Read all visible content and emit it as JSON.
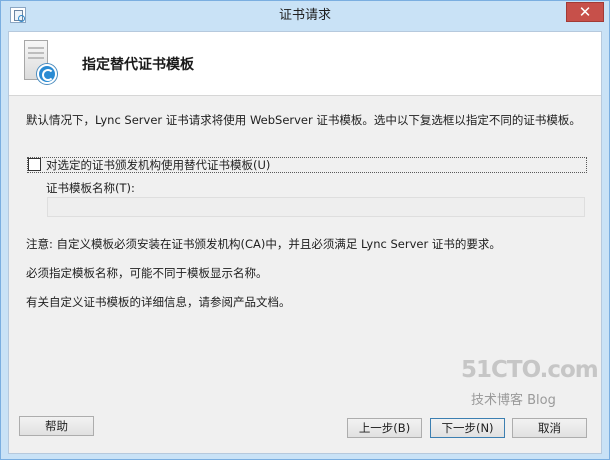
{
  "window": {
    "title": "证书请求",
    "close_label": "✕"
  },
  "header": {
    "title": "指定替代证书模板",
    "icon": "server-certificate-icon"
  },
  "content": {
    "description": "默认情况下，Lync Server 证书请求将使用 WebServer 证书模板。选中以下复选框以指定不同的证书模板。",
    "checkbox_label": "对选定的证书颁发机构使用替代证书模板(U)",
    "checkbox_checked": false,
    "template_name_label": "证书模板名称(T):",
    "template_name_value": "",
    "note1": "注意: 自定义模板必须安装在证书颁发机构(CA)中，并且必须满足 Lync Server 证书的要求。",
    "note2": "必须指定模板名称，可能不同于模板显示名称。",
    "note3": "有关自定义证书模板的详细信息，请参阅产品文档。"
  },
  "buttons": {
    "help": "帮助",
    "prev": "上一步(B)",
    "next": "下一步(N)",
    "cancel": "取消"
  },
  "watermark": {
    "main": "51CTO.com",
    "sub": "技术博客 Blog"
  }
}
